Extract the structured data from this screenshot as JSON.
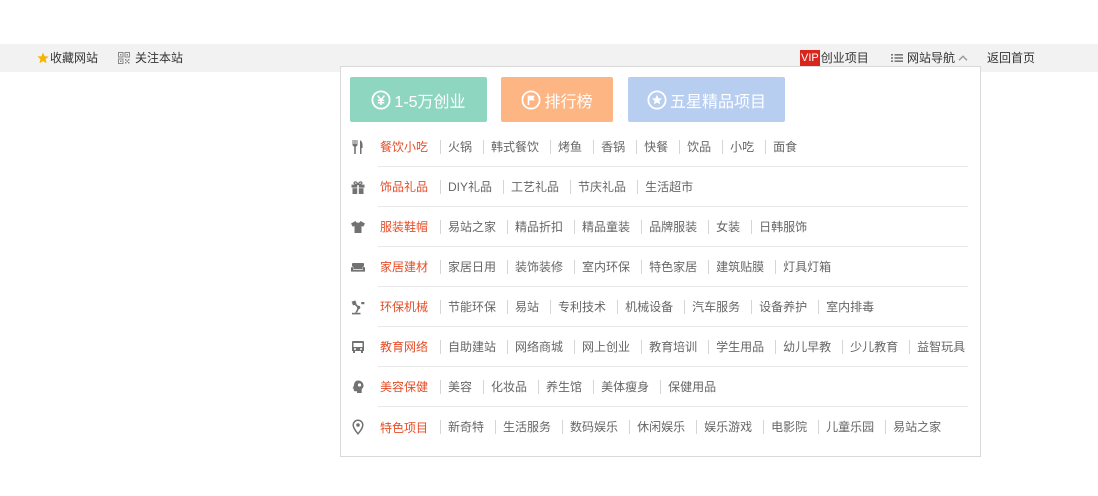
{
  "topbar": {
    "favorite": {
      "icon": "star-icon",
      "label": "收藏网站"
    },
    "follow": {
      "icon": "qrcode-icon",
      "label": "关注本站"
    },
    "vip": {
      "badge": "VIP",
      "label": "创业项目"
    },
    "site_nav": {
      "icon": "list-icon",
      "label": "网站导航",
      "state_icon": "chevron-up-icon"
    },
    "home": {
      "label": "返回首页"
    }
  },
  "colors": {
    "category_accent": "#e54d26",
    "vip_badge": "#d8261d",
    "favorite_star": "#f6b400",
    "topbar_background": "#f2f2f2"
  },
  "nav_panel": {
    "quick_buttons": [
      {
        "icon": "yen-circle-icon",
        "label": "1-5万创业",
        "color": "#8fd6c1"
      },
      {
        "icon": "flag-circle-icon",
        "label": "排行榜",
        "color": "#fdb584"
      },
      {
        "icon": "star-circle-icon",
        "label": "五星精品项目",
        "color": "#b8cef0"
      }
    ],
    "categories": [
      {
        "icon": "utensils-icon",
        "name": "餐饮小吃",
        "items": [
          "火锅",
          "韩式餐饮",
          "烤鱼",
          "香锅",
          "快餐",
          "饮品",
          "小吃",
          "面食"
        ]
      },
      {
        "icon": "gift-icon",
        "name": "饰品礼品",
        "items": [
          "DIY礼品",
          "工艺礼品",
          "节庆礼品",
          "生活超市"
        ]
      },
      {
        "icon": "tshirt-icon",
        "name": "服装鞋帽",
        "items": [
          "易站之家",
          "精品折扣",
          "精品童装",
          "品牌服装",
          "女装",
          "日韩服饰"
        ]
      },
      {
        "icon": "sofa-icon",
        "name": "家居建材",
        "items": [
          "家居日用",
          "装饰装修",
          "室内环保",
          "特色家居",
          "建筑贴膜",
          "灯具灯箱"
        ]
      },
      {
        "icon": "machine-icon",
        "name": "环保机械",
        "items": [
          "节能环保",
          "易站",
          "专利技术",
          "机械设备",
          "汽车服务",
          "设备养护",
          "室内排毒"
        ]
      },
      {
        "icon": "bus-icon",
        "name": "教育网络",
        "items": [
          "自助建站",
          "网络商城",
          "网上创业",
          "教育培训",
          "学生用品",
          "幼儿早教",
          "少儿教育",
          "益智玩具"
        ]
      },
      {
        "icon": "face-icon",
        "name": "美容保健",
        "items": [
          "美容",
          "化妆品",
          "养生馆",
          "美体瘦身",
          "保健用品"
        ]
      },
      {
        "icon": "location-pin-icon",
        "name": "特色项目",
        "items": [
          "新奇特",
          "生活服务",
          "数码娱乐",
          "休闲娱乐",
          "娱乐游戏",
          "电影院",
          "儿童乐园",
          "易站之家"
        ]
      }
    ]
  }
}
